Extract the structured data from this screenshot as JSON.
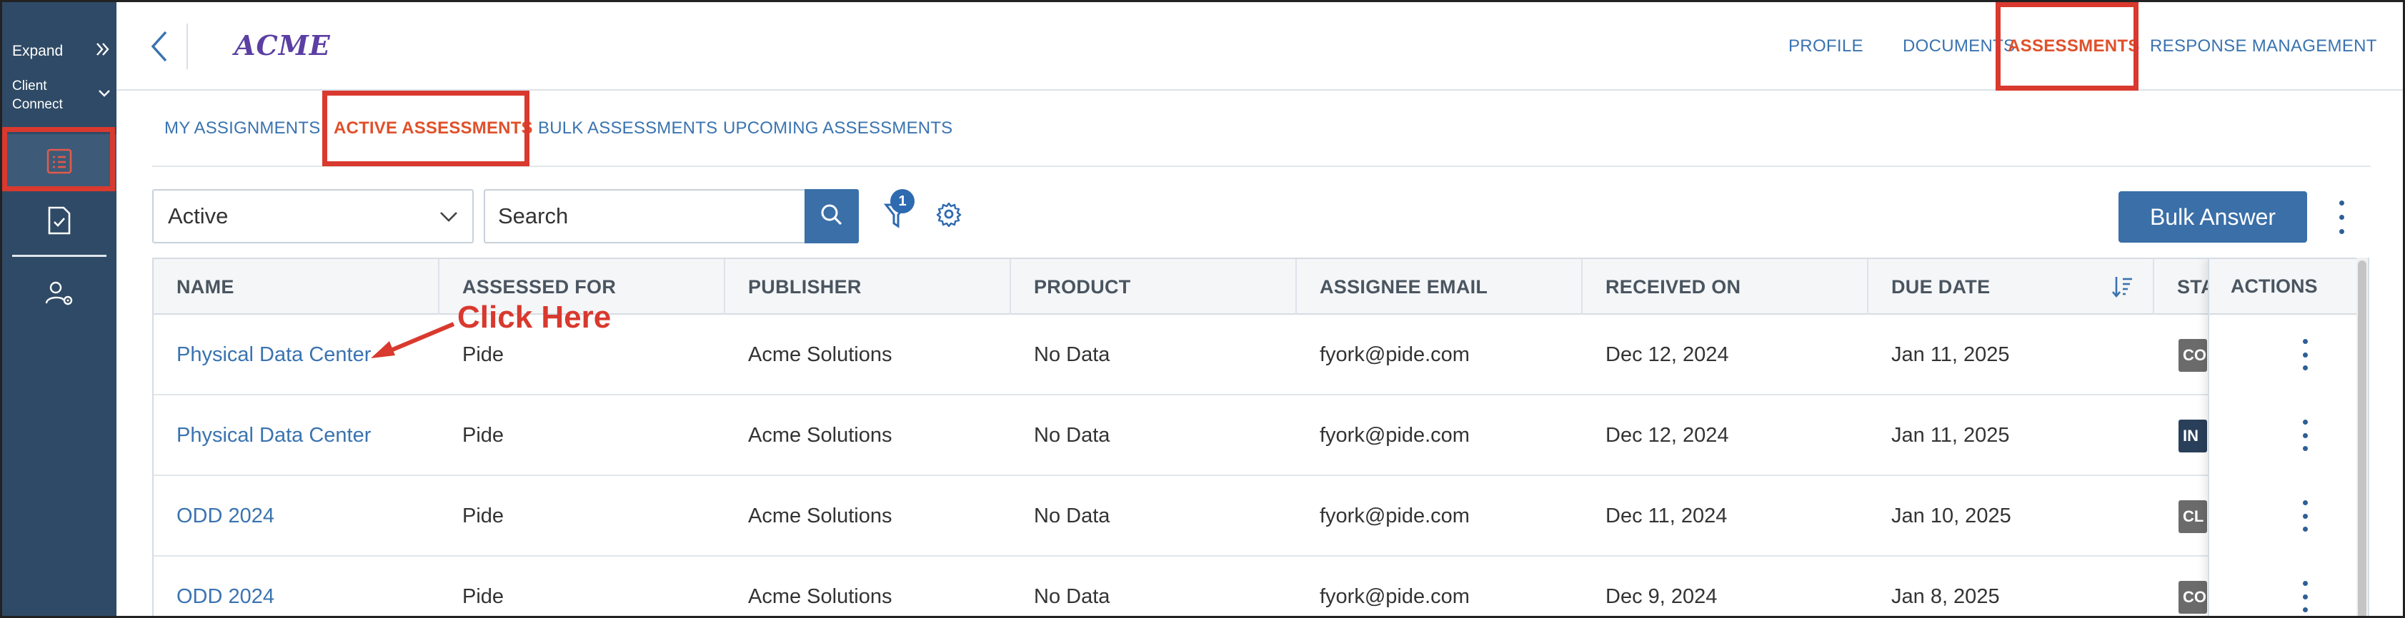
{
  "sidebar": {
    "expand_label": "Expand",
    "client_label": "Client Connect"
  },
  "header": {
    "logo": "ACME",
    "nav": [
      "PROFILE",
      "DOCUMENTS",
      "ASSESSMENTS",
      "RESPONSE MANAGEMENT"
    ],
    "active_nav": "ASSESSMENTS"
  },
  "subtabs": [
    "MY ASSIGNMENTS",
    "ACTIVE ASSESSMENTS",
    "BULK ASSESSMENTS",
    "UPCOMING ASSESSMENTS"
  ],
  "toolbar": {
    "status_value": "Active",
    "search_placeholder": "Search",
    "filter_count": "1",
    "bulk_answer_label": "Bulk Answer"
  },
  "table": {
    "columns": [
      "NAME",
      "ASSESSED FOR",
      "PUBLISHER",
      "PRODUCT",
      "ASSIGNEE EMAIL",
      "RECEIVED ON",
      "DUE DATE",
      "STA",
      "ACTIONS"
    ],
    "rows": [
      {
        "name": "Physical Data Center",
        "assessed_for": "Pide",
        "publisher": "Acme Solutions",
        "product": "No Data",
        "email": "fyork@pide.com",
        "received": "Dec 12, 2024",
        "due": "Jan 11, 2025",
        "status": "CO",
        "status_color": "#6b6b6b"
      },
      {
        "name": "Physical Data Center",
        "assessed_for": "Pide",
        "publisher": "Acme Solutions",
        "product": "No Data",
        "email": "fyork@pide.com",
        "received": "Dec 12, 2024",
        "due": "Jan 11, 2025",
        "status": "IN",
        "status_color": "#2a3f5a"
      },
      {
        "name": "ODD 2024",
        "assessed_for": "Pide",
        "publisher": "Acme Solutions",
        "product": "No Data",
        "email": "fyork@pide.com",
        "received": "Dec 11, 2024",
        "due": "Jan 10, 2025",
        "status": "CL",
        "status_color": "#6b6b6b"
      },
      {
        "name": "ODD 2024",
        "assessed_for": "Pide",
        "publisher": "Acme Solutions",
        "product": "No Data",
        "email": "fyork@pide.com",
        "received": "Dec 9, 2024",
        "due": "Jan 8, 2025",
        "status": "CO",
        "status_color": "#6b6b6b"
      }
    ]
  },
  "annotation": {
    "text": "Click Here",
    "color": "#d9392e"
  },
  "colors": {
    "sidebar": "#2f4a66",
    "accent": "#3a6fa8",
    "active_tab": "#e0502a",
    "highlight": "#d9392e"
  }
}
